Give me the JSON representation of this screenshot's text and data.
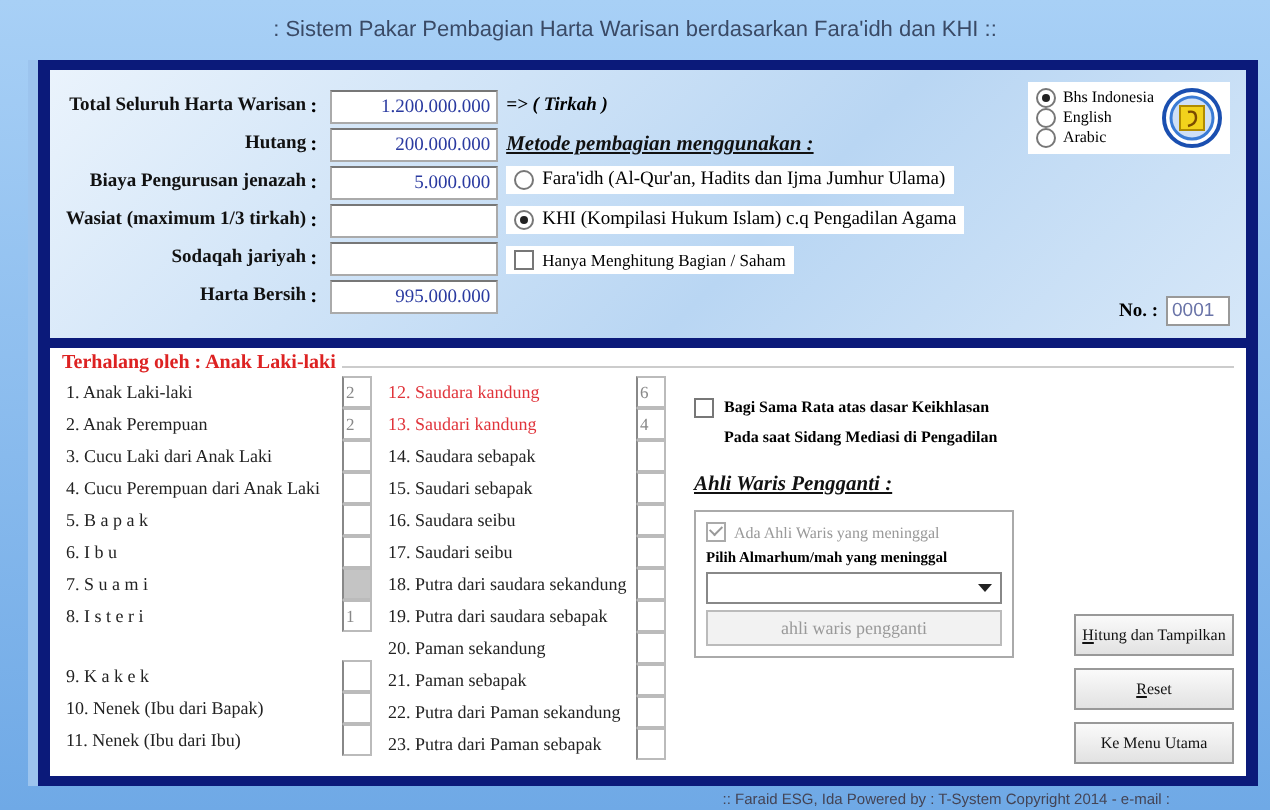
{
  "window": {
    "title": ": Sistem Pakar Pembagian Harta Warisan berdasarkan Fara'idh dan KHI ::"
  },
  "amounts": [
    {
      "label": "Total Seluruh Harta Warisan",
      "value": "1.200.000.000"
    },
    {
      "label": "Hutang",
      "value": "200.000.000"
    },
    {
      "label": "Biaya Pengurusan jenazah",
      "value": "5.000.000"
    },
    {
      "label": "Wasiat (maximum 1/3 tirkah)"
    },
    {
      "label": "Sodaqah jariyah"
    },
    {
      "label": "Harta Bersih",
      "value": "995.000.000"
    }
  ],
  "separator": ":",
  "tirkah_note": "=> ( Tirkah )",
  "method": {
    "heading": "Metode pembagian menggunakan :",
    "options": [
      {
        "label": "Fara'idh (Al-Qur'an, Hadits dan Ijma Jumhur Ulama)",
        "selected": false
      },
      {
        "label": "KHI (Kompilasi Hukum Islam) c.q Pengadilan Agama",
        "selected": true
      }
    ],
    "checkbox": {
      "label": "Hanya Menghitung Bagian / Saham",
      "checked": false
    }
  },
  "language": [
    {
      "label": "Bhs Indonesia",
      "selected": true
    },
    {
      "label": "English",
      "selected": false
    },
    {
      "label": "Arabic",
      "selected": false
    }
  ],
  "number": {
    "label": "No. :",
    "value": "0001"
  },
  "heirs": {
    "legend": "Terhalang oleh : Anak Laki-laki",
    "columns": [
      [
        {
          "num": "1.",
          "name": "Anak Laki-laki",
          "count": "2",
          "blocked": false,
          "disabled": false
        },
        {
          "num": "2.",
          "name": "Anak Perempuan",
          "count": "2",
          "blocked": false,
          "disabled": false
        },
        {
          "num": "3.",
          "name": "Cucu Laki dari Anak Laki",
          "blocked": false,
          "disabled": false
        },
        {
          "num": "4.",
          "name": "Cucu Perempuan dari Anak Laki",
          "blocked": false,
          "disabled": false
        },
        {
          "num": "5.",
          "name": "B a p a k",
          "blocked": false,
          "disabled": false
        },
        {
          "num": "6.",
          "name": "I b u",
          "blocked": false,
          "disabled": false
        },
        {
          "num": "7.",
          "name": "S u a m i",
          "blocked": false,
          "disabled": true
        },
        {
          "num": "8.",
          "name": "I s t e r i",
          "count": "1",
          "blocked": false,
          "disabled": false
        },
        {
          "num": "9.",
          "name": "K a k e k",
          "blocked": false,
          "disabled": false,
          "gap_before": true
        },
        {
          "num": "10.",
          "name": "Nenek (Ibu dari Bapak)",
          "blocked": false,
          "disabled": false
        },
        {
          "num": "11.",
          "name": "Nenek (Ibu dari Ibu)",
          "blocked": false,
          "disabled": false
        }
      ],
      [
        {
          "num": "12.",
          "name": "Saudara kandung",
          "count": "6",
          "blocked": true,
          "disabled": false
        },
        {
          "num": "13.",
          "name": "Saudari  kandung",
          "count": "4",
          "blocked": true,
          "disabled": false
        },
        {
          "num": "14.",
          "name": "Saudara sebapak",
          "blocked": false,
          "disabled": false
        },
        {
          "num": "15.",
          "name": "Saudari  sebapak",
          "blocked": false,
          "disabled": false
        },
        {
          "num": "16.",
          "name": "Saudara seibu",
          "blocked": false,
          "disabled": false
        },
        {
          "num": "17.",
          "name": "Saudari  seibu",
          "blocked": false,
          "disabled": false
        },
        {
          "num": "18.",
          "name": "Putra dari saudara sekandung",
          "blocked": false,
          "disabled": false
        },
        {
          "num": "19.",
          "name": "Putra dari saudara sebapak",
          "blocked": false,
          "disabled": false
        },
        {
          "num": "20.",
          "name": "Paman sekandung",
          "blocked": false,
          "disabled": false
        },
        {
          "num": "21.",
          "name": "Paman sebapak",
          "blocked": false,
          "disabled": false
        },
        {
          "num": "22.",
          "name": "Putra dari Paman sekandung",
          "blocked": false,
          "disabled": false
        },
        {
          "num": "23.",
          "name": "Putra dari Paman sebapak",
          "blocked": false,
          "disabled": false
        }
      ]
    ]
  },
  "equal_share": {
    "lines": [
      "Bagi Sama Rata atas dasar Keikhlasan",
      "Pada saat Sidang Mediasi di Pengadilan"
    ],
    "checked": false
  },
  "replacement": {
    "heading": "Ahli Waris Pengganti :",
    "checkbox": {
      "label": "Ada Ahli Waris yang meninggal",
      "checked": true,
      "disabled": true
    },
    "select_label": "Pilih Almarhum/mah yang meninggal",
    "button": "ahli waris pengganti"
  },
  "buttons": [
    {
      "mnemonic": "H",
      "rest": "itung dan Tampilkan"
    },
    {
      "mnemonic": "R",
      "rest": "eset"
    },
    {
      "rest": "Ke Menu Utama"
    }
  ],
  "footer": ":: Faraid ESG, Ida Powered by : T-System Copyright 2014 - e-mail :"
}
